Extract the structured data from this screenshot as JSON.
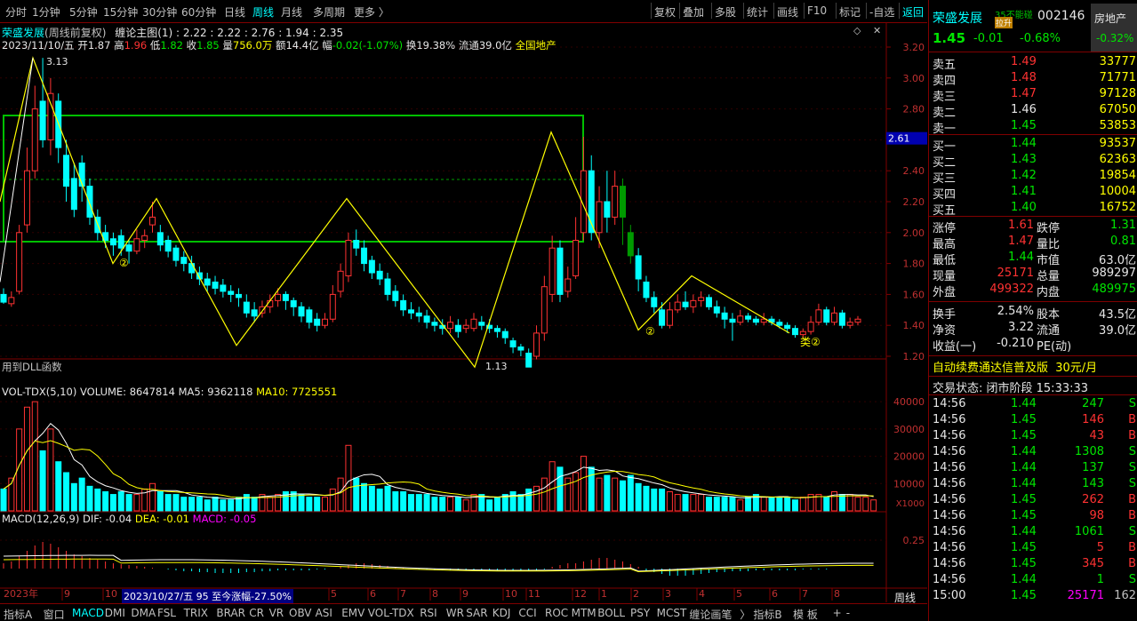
{
  "toolbar": {
    "timeframes": [
      "分时",
      "1分钟",
      "5分钟",
      "15分钟",
      "30分钟",
      "60分钟",
      "日线",
      "周线",
      "月线",
      "多周期",
      "更多 〉"
    ],
    "active_timeframe": "周线",
    "right_buttons": [
      "复权",
      "叠加",
      "多股",
      "统计",
      "画线",
      "F10",
      "标记",
      "-自选",
      "返回"
    ]
  },
  "header": {
    "stock_name": "荣盛发展",
    "chart_mode": "(周线前复权)",
    "indicator": "缠论主图(1) : 2.22 : 2.22 : 2.76 : 1.94 : 2.35",
    "date": "2023/11/10/五",
    "open_label": "开",
    "open": "1.87",
    "high_label": "高",
    "high": "1.96",
    "low_label": "低",
    "low": "1.82",
    "close_label": "收",
    "close": "1.85",
    "vol_label": "量",
    "vol": "756.0万",
    "amount_label": "额",
    "amount": "14.4亿",
    "chg_label": "幅",
    "chg": "-0.02(-1.07%)",
    "turnover_label": "换",
    "turnover": "19.38%",
    "float_label": "流通",
    "float": "39.0亿",
    "sector": "全国地产"
  },
  "price_axis": [
    "3.20",
    "3.00",
    "2.80",
    "2.60",
    "2.40",
    "2.20",
    "2.00",
    "1.80",
    "1.60",
    "1.40",
    "1.20"
  ],
  "price_marker": "2.61",
  "annotations": {
    "high_label": "3.13",
    "low_label": "1.13",
    "dll": "用到DLL函数",
    "mark2a": "②",
    "mark2b": "②",
    "mark2c": "类②"
  },
  "volume_panel": {
    "title": "VOL-TDX(5,10)",
    "volume": "VOLUME: 8647814",
    "ma5": "MA5: 9362118",
    "ma10": "MA10: 7725551",
    "axis": [
      "40000",
      "30000",
      "20000",
      "10000"
    ],
    "unit": "X1000"
  },
  "macd_panel": {
    "title": "MACD(12,26,9)",
    "dif": "DIF: -0.04",
    "dea": "DEA: -0.01",
    "macd": "MACD: -0.05",
    "axis": [
      "0.25"
    ]
  },
  "time_axis": {
    "labels": [
      "2023年",
      "9",
      "10",
      "5",
      "6",
      "7",
      "8",
      "9",
      "10",
      "11",
      "12",
      "1",
      "2",
      "3",
      "4",
      "5",
      "6",
      "7",
      "8"
    ],
    "highlight": "2023/10/27/五 95 至今涨幅-27.50%",
    "period": "周线"
  },
  "bottom_tabs": [
    "指标A",
    "窗口",
    "MACD",
    "DMI",
    "DMA",
    "FSL",
    "TRIX",
    "BRAR",
    "CR",
    "VR",
    "OBV",
    "ASI",
    "EMV",
    "VOL-TDX",
    "RSI",
    "WR",
    "SAR",
    "KDJ",
    "CCI",
    "ROC",
    "MTM",
    "BOLL",
    "PSY",
    "MCST",
    "缠论画笔",
    "〉",
    "指标B",
    "模 板",
    "+",
    "-"
  ],
  "active_bottom_tab": "MACD",
  "quote": {
    "name": "荣盛发展",
    "tag": "35不能碰",
    "code": "002146",
    "flag": "拉升",
    "sector": "房地产",
    "sector_chg": "-0.32%",
    "price": "1.45",
    "change": "-0.01",
    "change_pct": "-0.68%",
    "asks": [
      {
        "label": "卖五",
        "price": "1.49",
        "vol": "33777"
      },
      {
        "label": "卖四",
        "price": "1.48",
        "vol": "71771"
      },
      {
        "label": "卖三",
        "price": "1.47",
        "vol": "97128"
      },
      {
        "label": "卖二",
        "price": "1.46",
        "vol": "67050"
      },
      {
        "label": "卖一",
        "price": "1.45",
        "vol": "53853"
      }
    ],
    "bids": [
      {
        "label": "买一",
        "price": "1.44",
        "vol": "93537"
      },
      {
        "label": "买二",
        "price": "1.43",
        "vol": "62363"
      },
      {
        "label": "买三",
        "price": "1.42",
        "vol": "19854"
      },
      {
        "label": "买四",
        "price": "1.41",
        "vol": "10004"
      },
      {
        "label": "买五",
        "price": "1.40",
        "vol": "16752"
      }
    ],
    "stats": [
      {
        "l1": "涨停",
        "v1": "1.61",
        "l2": "跌停",
        "v2": "1.31"
      },
      {
        "l1": "最高",
        "v1": "1.47",
        "l2": "量比",
        "v2": "0.81"
      },
      {
        "l1": "最低",
        "v1": "1.44",
        "l2": "市值",
        "v2": "63.0亿"
      },
      {
        "l1": "现量",
        "v1": "25171",
        "l2": "总量",
        "v2": "989297"
      },
      {
        "l1": "外盘",
        "v1": "499322",
        "l2": "内盘",
        "v2": "489975"
      }
    ],
    "stats2": [
      {
        "l1": "换手",
        "v1": "2.54%",
        "l2": "股本",
        "v2": "43.5亿"
      },
      {
        "l1": "净资",
        "v1": "3.22",
        "l2": "流通",
        "v2": "39.0亿"
      },
      {
        "l1": "收益(一)",
        "v1": "-0.210",
        "l2": "PE(动)",
        "v2": ""
      }
    ],
    "promo": "自动续费通达信普及版  30元/月",
    "status": "交易状态: 闭市阶段 15:33:33",
    "ticks": [
      {
        "t": "14:56",
        "p": "1.44",
        "v": "247",
        "d": "S"
      },
      {
        "t": "14:56",
        "p": "1.45",
        "v": "146",
        "d": "B"
      },
      {
        "t": "14:56",
        "p": "1.45",
        "v": "43",
        "d": "B"
      },
      {
        "t": "14:56",
        "p": "1.44",
        "v": "1308",
        "d": "S"
      },
      {
        "t": "14:56",
        "p": "1.44",
        "v": "137",
        "d": "S"
      },
      {
        "t": "14:56",
        "p": "1.44",
        "v": "143",
        "d": "S"
      },
      {
        "t": "14:56",
        "p": "1.45",
        "v": "262",
        "d": "B"
      },
      {
        "t": "14:56",
        "p": "1.45",
        "v": "98",
        "d": "B"
      },
      {
        "t": "14:56",
        "p": "1.44",
        "v": "1061",
        "d": "S"
      },
      {
        "t": "14:56",
        "p": "1.45",
        "v": "5",
        "d": "B"
      },
      {
        "t": "14:56",
        "p": "1.45",
        "v": "345",
        "d": "B"
      },
      {
        "t": "14:56",
        "p": "1.44",
        "v": "1",
        "d": "S"
      },
      {
        "t": "15:00",
        "p": "1.45",
        "v": "25171",
        "d": "162"
      }
    ]
  },
  "colors": {
    "up": "#ff3232",
    "down": "#00e600",
    "bar_down": "#00ffff",
    "bar_up": "#ff3232",
    "zone": "#00c000",
    "stroke": "#ffff00"
  }
}
